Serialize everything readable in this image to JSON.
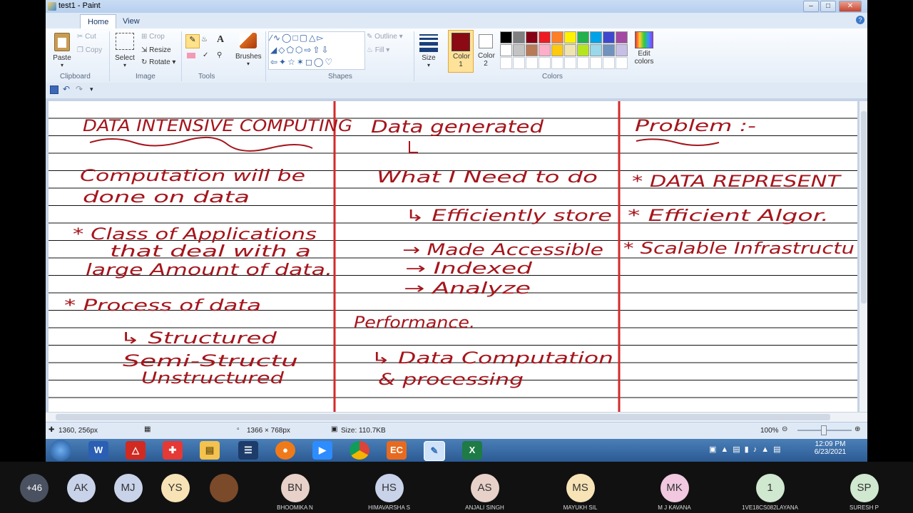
{
  "window": {
    "title": "test1 - Paint"
  },
  "tabs": {
    "file": "▤ ▾",
    "home": "Home",
    "view": "View"
  },
  "ribbon": {
    "clipboard": {
      "paste": "Paste",
      "cut": "Cut",
      "copy": "Copy",
      "label": "Clipboard"
    },
    "image": {
      "select": "Select",
      "crop": "Crop",
      "resize": "Resize",
      "rotate": "Rotate",
      "label": "Image"
    },
    "tools": {
      "label": "Tools"
    },
    "brushes": {
      "label": "Brushes"
    },
    "shapes": {
      "outline": "Outline",
      "fill": "Fill",
      "label": "Shapes"
    },
    "size": {
      "label": "Size"
    },
    "color1": {
      "label": "Color 1",
      "value": "#8b0a14"
    },
    "color2": {
      "label": "Color 2",
      "value": "#ffffff"
    },
    "colors": {
      "label": "Colors",
      "edit": "Edit colors",
      "row1": [
        "#000000",
        "#7f7f7f",
        "#880015",
        "#ed1c24",
        "#ff7f27",
        "#fff200",
        "#22b14c",
        "#00a2e8",
        "#3f48cc",
        "#a349a4"
      ],
      "row2": [
        "#ffffff",
        "#c3c3c3",
        "#b97a57",
        "#ffaec9",
        "#ffc90e",
        "#efe4b0",
        "#b5e61d",
        "#99d9ea",
        "#7092be",
        "#c8bfe7"
      ]
    }
  },
  "canvas": {
    "col1": {
      "heading": "DATA INTENSIVE COMPUTING",
      "lines": [
        "Computation will be",
        "done on data",
        "* Class of Applications",
        "that deal with a",
        "large Amount of data.",
        "* Process of data",
        "↳ Structured",
        "Semi-Structu",
        "Unstructured"
      ]
    },
    "col2": {
      "heading": "Data generated",
      "lines": [
        "What I Need to do",
        "↳ Efficiently store",
        "→ Made Accessible",
        "→ Indexed",
        "→ Analyze",
        "Performance.",
        "↳ Data Computation",
        "& processing"
      ]
    },
    "col3": {
      "heading": "Problem :-",
      "lines": [
        "* DATA REPRESENT",
        "* Efficient Algor.",
        "* Scalable Infrastructu"
      ]
    }
  },
  "status": {
    "cursor": "1360, 256px",
    "dimensions": "1366 × 768px",
    "size": "Size: 110.7KB",
    "zoom": "100%"
  },
  "taskbar": {
    "time": "12:09 PM",
    "date": "6/23/2021"
  },
  "participants": {
    "more": "+46",
    "initials": [
      {
        "initials": "AK",
        "color": "#c8d3ea",
        "name": ""
      },
      {
        "initials": "MJ",
        "color": "#c8d3ea",
        "name": ""
      },
      {
        "initials": "YS",
        "color": "#f7e3b5",
        "name": ""
      },
      {
        "initials": "",
        "color": "#7a4a2a",
        "name": ""
      },
      {
        "initials": "BN",
        "color": "#e8d1c8",
        "name": "BHOOMIKA N"
      },
      {
        "initials": "HS",
        "color": "#c8d3ea",
        "name": "HIMAVARSHA S"
      },
      {
        "initials": "AS",
        "color": "#e8d1c8",
        "name": "ANJALI SINGH"
      },
      {
        "initials": "MS",
        "color": "#f7e3b5",
        "name": "MAYUKH SIL"
      },
      {
        "initials": "MK",
        "color": "#f1c8e0",
        "name": "M J KAVANA"
      },
      {
        "initials": "1",
        "color": "#cfe8cf",
        "name": "1VE18CS082LAYANA"
      },
      {
        "initials": "SP",
        "color": "#cfe8cf",
        "name": "SURESH P"
      }
    ]
  }
}
